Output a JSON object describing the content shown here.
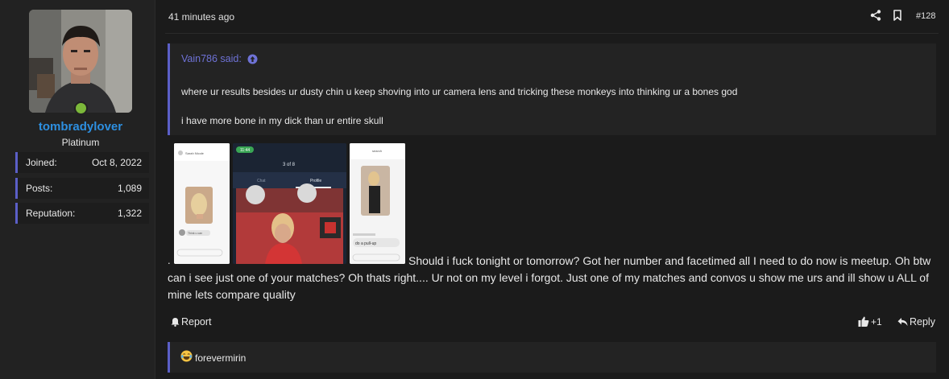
{
  "user": {
    "name": "tombradylover",
    "title": "Platinum",
    "stats": [
      {
        "label": "Joined:",
        "value": "Oct 8, 2022"
      },
      {
        "label": "Posts:",
        "value": "1,089"
      },
      {
        "label": "Reputation:",
        "value": "1,322"
      }
    ]
  },
  "post": {
    "time": "41 minutes ago",
    "number": "#128",
    "quote": {
      "author": "Vain786 said:",
      "line1": "where ur results besides ur dusty chin u keep shoving into ur camera lens and tricking these monkeys into thinking ur a bones god",
      "line2": "i have more bone in my dick than ur entire skull"
    },
    "thumbs": {
      "t1_name": "Sarah Nicole",
      "t1_msg": "Think u can",
      "t2_status": "11:44",
      "t2_count": "3 of 8",
      "t2_tab1": "Chat",
      "t2_tab2": "Profile",
      "t3_title": "search",
      "t3_msg": "do a pull-up"
    },
    "leading_dot": ".",
    "body": "Should i fuck tonight or tomorrow? Got her number and facetimed all I need to do now is meetup. Oh btw can i see just one of your matches? Oh thats right.... Ur not on my level i forgot. Just one of my matches and convos u show me urs and ill show u ALL of mine lets compare quality",
    "actions": {
      "report": "Report",
      "like_count": "+1",
      "reply": "Reply"
    },
    "reaction_user": "forevermirin"
  },
  "colors": {
    "accent": "#5b5fc7",
    "username": "#2d8fe0",
    "online": "#7cb83a"
  }
}
